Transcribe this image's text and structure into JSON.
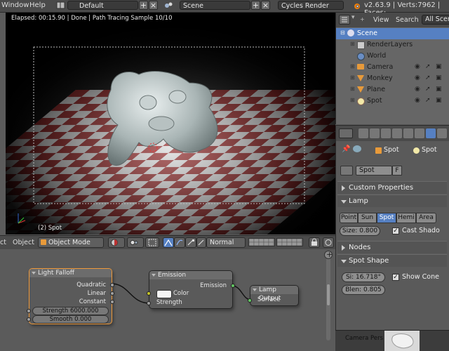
{
  "menubar": {
    "window_label": "Window",
    "help_label": "Help",
    "layout_value": "Default",
    "scene_value": "Scene",
    "engine_value": "Cycles Render",
    "version_stats": "v2.63.9 | Verts:7962 | Faces:"
  },
  "viewport": {
    "render_status": "Elapsed: 00:15.90 | Done | Path Tracing Sample 10/10",
    "object_label": "(2) Spot"
  },
  "viewport_header": {
    "object_menu": "Object",
    "mode_value": "Object Mode",
    "pivot_value": "Normal"
  },
  "outliner": {
    "view_label": "View",
    "search_label": "Search",
    "filter_value": "All Scene",
    "items": [
      {
        "label": "Scene",
        "icon": "scene-icon"
      },
      {
        "label": "RenderLayers",
        "icon": "renderlayers-icon"
      },
      {
        "label": "World",
        "icon": "world-icon"
      },
      {
        "label": "Camera",
        "icon": "camera-icon"
      },
      {
        "label": "Monkey",
        "icon": "mesh-icon"
      },
      {
        "label": "Plane",
        "icon": "mesh-icon"
      },
      {
        "label": "Spot",
        "icon": "lamp-icon"
      }
    ]
  },
  "properties": {
    "breadcrumb_object": "Spot",
    "breadcrumb_data": "Spot",
    "datablock_name": "Spot",
    "fake_user_label": "F",
    "panels": {
      "custom_properties": "Custom Properties",
      "lamp": "Lamp",
      "nodes": "Nodes",
      "spot_shape": "Spot Shape"
    },
    "lamp_types": [
      "Point",
      "Sun",
      "Spot",
      "Hemi",
      "Area"
    ],
    "selected_lamp_type": "Spot",
    "size_field": "Size: 0.800",
    "cast_shadow_label": "Cast Shado",
    "spot_size_field": "Si: 16.718°",
    "blend_field": "Blen: 0.805",
    "show_cone_label": "Show Cone"
  },
  "nodes": {
    "light_falloff": {
      "title": "Light Falloff",
      "outputs": [
        "Quadratic",
        "Linear",
        "Constant"
      ],
      "strength_field": "Strength 6000.000",
      "smooth_field": "Smooth 0.000"
    },
    "emission": {
      "title": "Emission",
      "output": "Emission",
      "color_label": "Color",
      "strength_label": "Strength"
    },
    "lamp_output": {
      "title": "Lamp Output",
      "input": "Surface"
    }
  },
  "preview": {
    "label": "Camera Pers"
  },
  "colors": {
    "active_blue": "#5680c2",
    "socket_yellow": "#c7c729",
    "socket_gray": "#a1a1a1",
    "socket_green": "#63c763",
    "node_selected": "#f09a3a"
  }
}
